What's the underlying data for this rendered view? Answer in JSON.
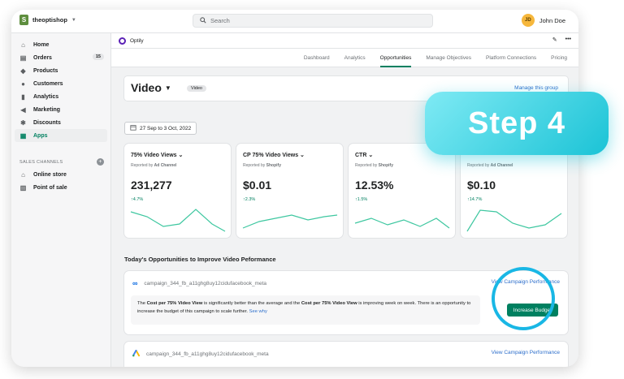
{
  "topbar": {
    "store_name": "theoptishop",
    "search_placeholder": "Search",
    "user_initials": "JD",
    "user_name": "John Doe"
  },
  "sidebar": {
    "items": [
      {
        "label": "Home",
        "icon": "home-icon"
      },
      {
        "label": "Orders",
        "icon": "orders-icon",
        "badge": "15"
      },
      {
        "label": "Products",
        "icon": "tag-icon"
      },
      {
        "label": "Customers",
        "icon": "person-icon"
      },
      {
        "label": "Analytics",
        "icon": "bar-chart-icon"
      },
      {
        "label": "Marketing",
        "icon": "megaphone-icon"
      },
      {
        "label": "Discounts",
        "icon": "discount-icon"
      },
      {
        "label": "Apps",
        "icon": "apps-icon",
        "active": true
      }
    ],
    "sales_channels_title": "SALES CHANNELS",
    "channels": [
      {
        "label": "Online store",
        "icon": "store-icon"
      },
      {
        "label": "Point of sale",
        "icon": "pos-icon"
      }
    ]
  },
  "app": {
    "name": "Optily"
  },
  "tabs": [
    "Dashboard",
    "Analytics",
    "Opportunities",
    "Manage Objectives",
    "Platform Connections",
    "Pricing"
  ],
  "active_tab": "Opportunities",
  "page": {
    "title": "Video",
    "chip": "Video",
    "manage_link": "Manage this group",
    "date_range": "27 Sep to 3 Oct, 2022"
  },
  "metrics": [
    {
      "title": "75% Video Views",
      "reported_by": "Reported by",
      "source": "Ad Channel",
      "value": "231,277",
      "delta": "4.7%"
    },
    {
      "title": "CP 75% Video Views",
      "reported_by": "Reported by",
      "source": "Shopify",
      "value": "$0.01",
      "delta": "2.3%"
    },
    {
      "title": "CTR",
      "reported_by": "Reported by",
      "source": "Shopify",
      "value": "12.53%",
      "delta": "1.5%"
    },
    {
      "title": "",
      "reported_by": "Reported by",
      "source": "Ad Channel",
      "value": "$0.10",
      "delta": "14.7%"
    }
  ],
  "opportunities": {
    "title": "Today's Opportunities to Improve Video Peformance",
    "items": [
      {
        "campaign": "campaign_344_fb_a11ghg8uy12cidufacebook_meta",
        "link": "View Campaign Performance",
        "text_1": "The ",
        "bold_1": "Cost per 75% Video View",
        "text_2": " is significantly better than the average and the ",
        "bold_2": "Cost per 75% Video View",
        "text_3": " is improving week on week. There is an opportunity to increase the budget of this campaign to scale further. ",
        "see_why": "See why",
        "button": "Increase Budget"
      },
      {
        "campaign": "campaign_344_fb_a11ghg8uy12cidufacebook_meta",
        "link": "View Campaign Performance"
      }
    ]
  },
  "overlay": {
    "step_label": "Step 4",
    "accent": "#19b7e5"
  },
  "colors": {
    "brand_green": "#008060",
    "link_blue": "#2c6ecb",
    "optily_purple": "#5b21b6"
  }
}
